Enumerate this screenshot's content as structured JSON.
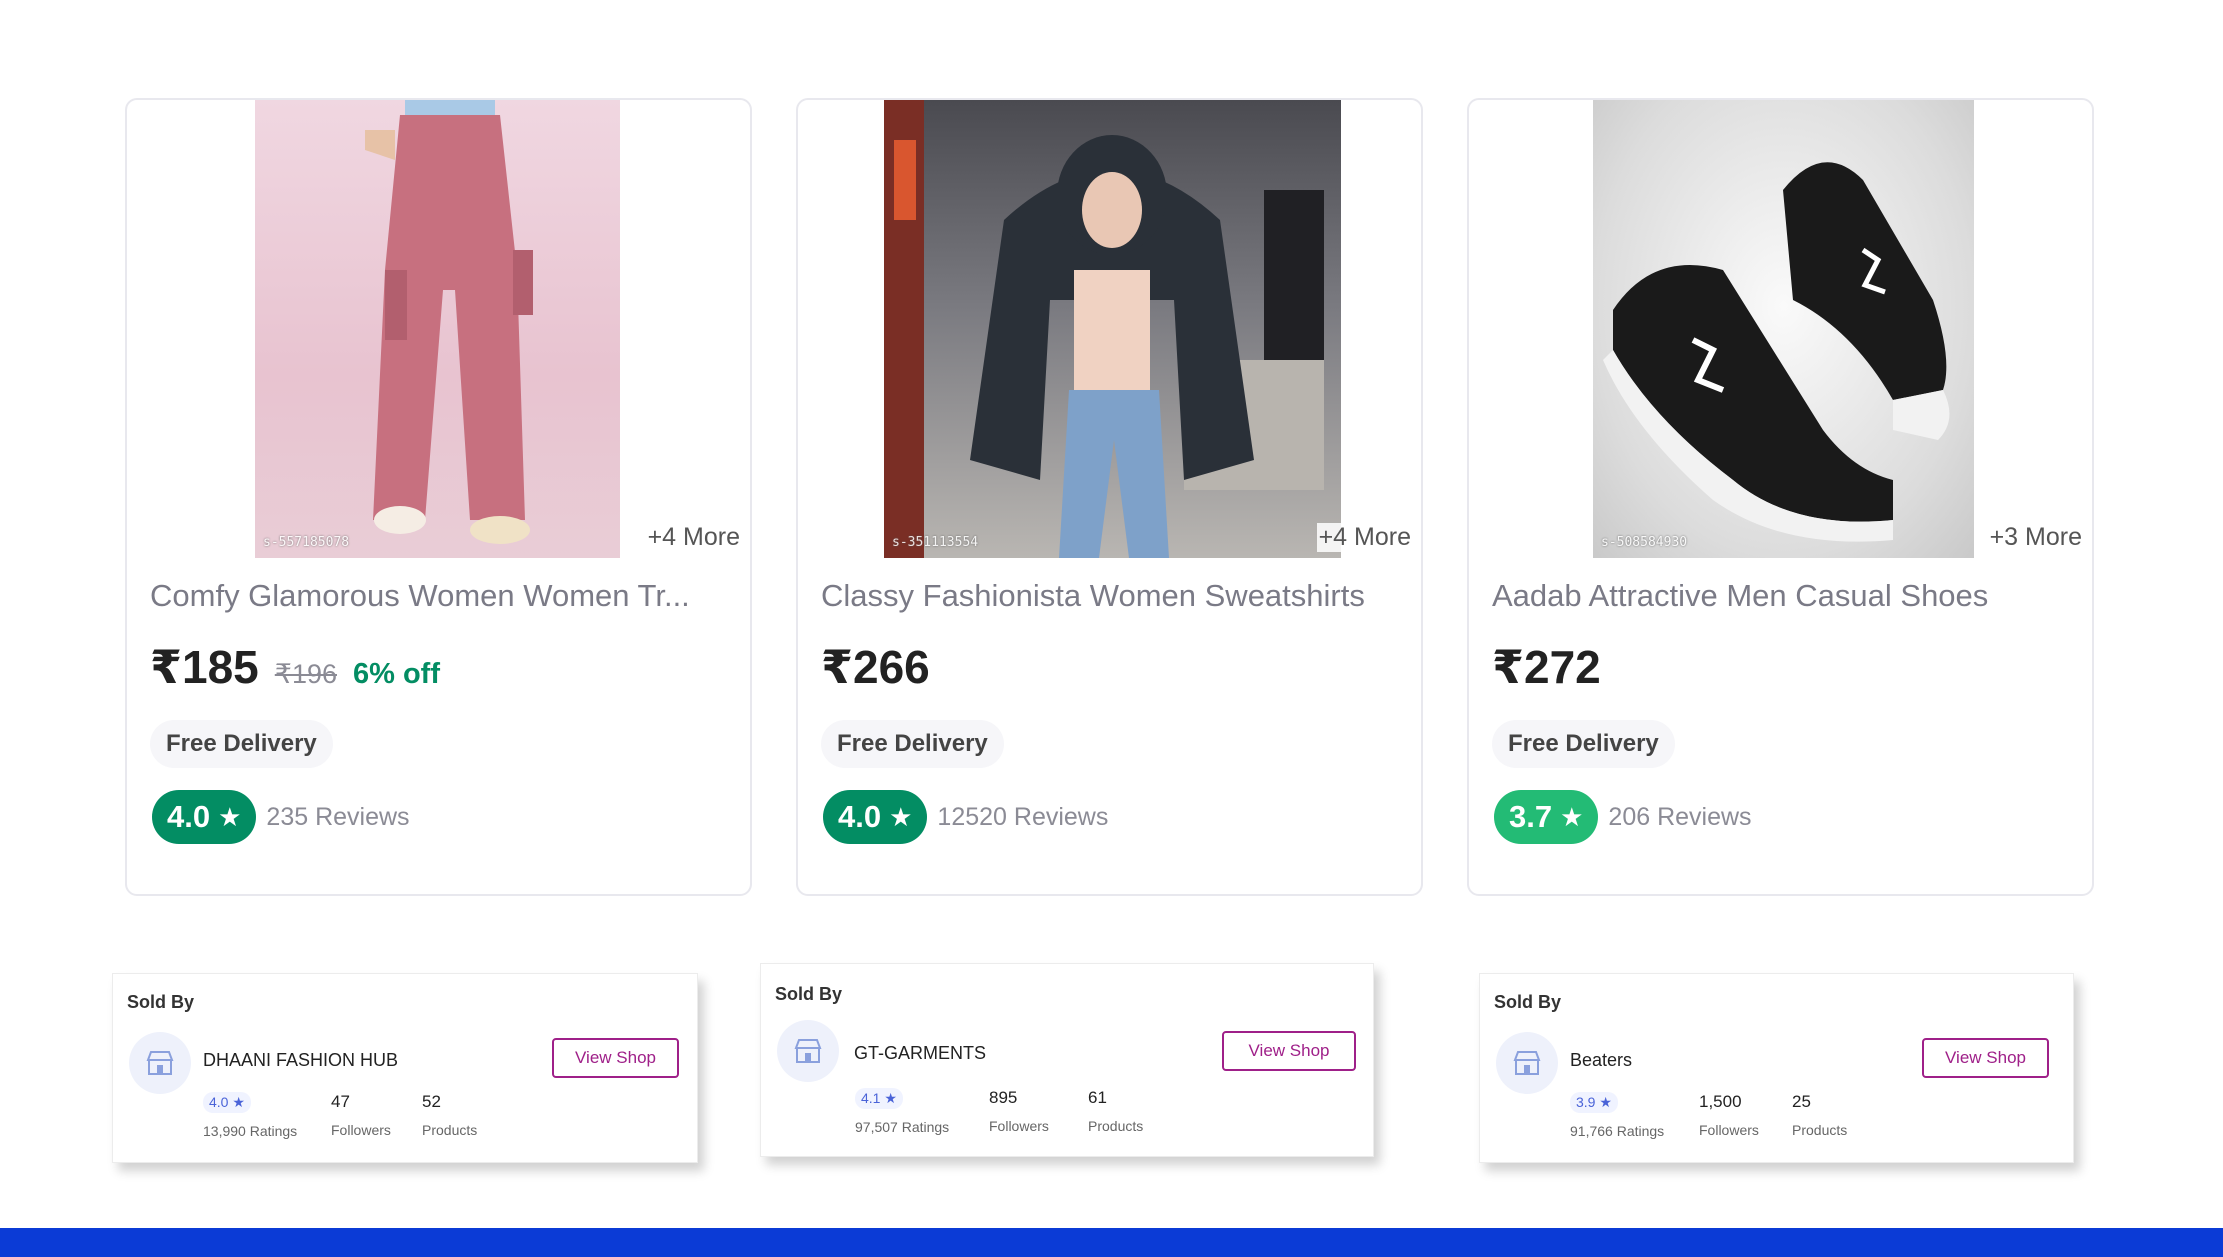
{
  "products": [
    {
      "title": "Comfy Glamorous Women Women Tr...",
      "price": "₹185",
      "mrp": "₹196",
      "discount": "6% off",
      "more": "+4 More",
      "delivery": "Free Delivery",
      "rating": "4.0",
      "rating_color": "#038d63",
      "reviews": "235 Reviews",
      "sku": "s-557185078"
    },
    {
      "title": "Classy Fashionista Women Sweatshirts",
      "price": "₹266",
      "more": "+4 More",
      "delivery": "Free Delivery",
      "rating": "4.0",
      "rating_color": "#038d63",
      "reviews": "12520 Reviews",
      "sku": "s-351113554"
    },
    {
      "title": "Aadab Attractive Men Casual Shoes",
      "price": "₹272",
      "more": "+3 More",
      "delivery": "Free Delivery",
      "rating": "3.7",
      "rating_color": "#23bb75",
      "reviews": "206 Reviews",
      "sku": "s-508584930"
    }
  ],
  "sellers": [
    {
      "sold_by": "Sold By",
      "name": "DHAANI FASHION HUB",
      "view_shop": "View Shop",
      "rating": "4.0 ★",
      "ratings_label": "13,990 Ratings",
      "followers": "47",
      "followers_label": "Followers",
      "products": "52",
      "products_label": "Products"
    },
    {
      "sold_by": "Sold By",
      "name": "GT-GARMENTS",
      "view_shop": "View Shop",
      "rating": "4.1 ★",
      "ratings_label": "97,507 Ratings",
      "followers": "895",
      "followers_label": "Followers",
      "products": "61",
      "products_label": "Products"
    },
    {
      "sold_by": "Sold By",
      "name": "Beaters",
      "view_shop": "View Shop",
      "rating": "3.9 ★",
      "ratings_label": "91,766 Ratings",
      "followers": "1,500",
      "followers_label": "Followers",
      "products": "25",
      "products_label": "Products"
    }
  ],
  "colors": {
    "accent": "#9f2089",
    "bottom_bar": "#0b3bd6",
    "discount": "#038d63"
  },
  "icons": {
    "star": "star-icon",
    "shop": "shop-icon"
  }
}
